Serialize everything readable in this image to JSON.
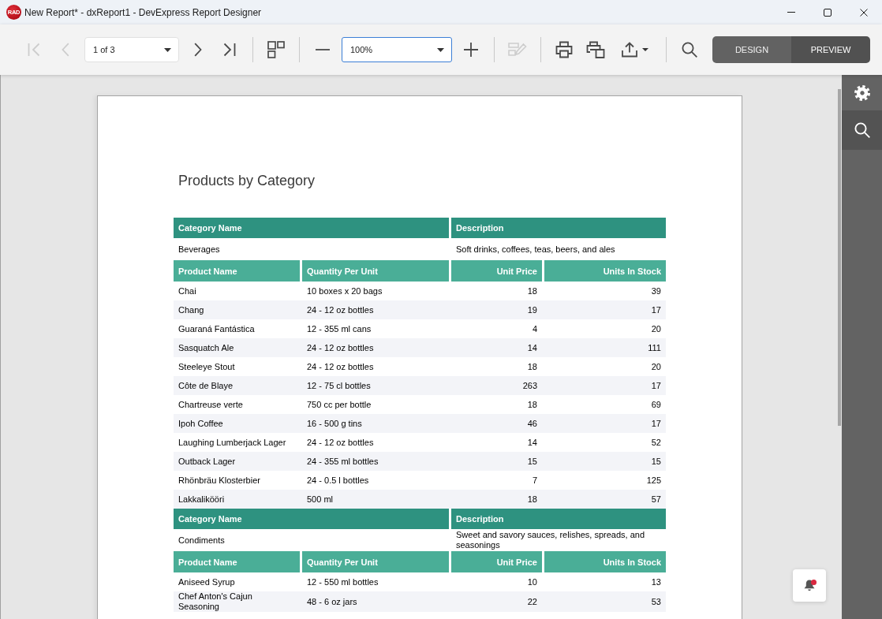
{
  "window": {
    "logo": "RAD",
    "title": "New Report* - dxReport1 - DevExpress Report Designer"
  },
  "toolbar": {
    "groups": [
      [
        {
          "kind": "first",
          "disabled": true
        },
        {
          "kind": "previous",
          "disabled": true
        },
        {
          "kind": "pages",
          "value": "1 of 3"
        },
        {
          "kind": "next",
          "disabled": false
        },
        {
          "kind": "last",
          "disabled": false
        }
      ],
      [
        {
          "kind": "multipage",
          "disabled": false
        }
      ],
      [
        {
          "kind": "zoomout",
          "disabled": false
        },
        {
          "kind": "zoom",
          "value": "100%",
          "focused": true
        },
        {
          "kind": "zoomin",
          "disabled": false
        }
      ],
      [
        {
          "kind": "edit",
          "disabled": true
        }
      ],
      [
        {
          "kind": "print",
          "disabled": false
        },
        {
          "kind": "quickprint",
          "disabled": false
        },
        {
          "kind": "export",
          "disabled": false
        }
      ],
      [
        {
          "kind": "search",
          "disabled": false
        }
      ]
    ],
    "mode_switch": [
      {
        "label": "DESIGN",
        "selected": false
      },
      {
        "label": "PREVIEW",
        "selected": true
      }
    ]
  },
  "side_panel": {
    "tabs": [
      {
        "kind": "settings",
        "selected": false
      },
      {
        "kind": "search",
        "selected": true
      }
    ]
  },
  "notifications": {
    "unread": true
  },
  "report": {
    "title": "Products by Category",
    "categories": [
      {
        "header": [
          "Category Name",
          "Description"
        ],
        "name": "Beverages",
        "description": "Soft drinks, coffees, teas, beers, and ales",
        "columns": [
          "Product Name",
          "Quantity Per Unit",
          "Unit Price",
          "Units In Stock"
        ],
        "products": [
          {
            "name": "Chai",
            "quantity": "10 boxes x 20 bags",
            "price": "18",
            "stock": "39"
          },
          {
            "name": "Chang",
            "quantity": "24 - 12 oz bottles",
            "price": "19",
            "stock": "17"
          },
          {
            "name": "Guaraná Fantástica",
            "quantity": "12 - 355 ml cans",
            "price": "4",
            "stock": "20"
          },
          {
            "name": "Sasquatch Ale",
            "quantity": "24 - 12 oz bottles",
            "price": "14",
            "stock": "111"
          },
          {
            "name": "Steeleye Stout",
            "quantity": "24 - 12 oz bottles",
            "price": "18",
            "stock": "20"
          },
          {
            "name": "Côte de Blaye",
            "quantity": "12 - 75 cl bottles",
            "price": "263",
            "stock": "17"
          },
          {
            "name": "Chartreuse verte",
            "quantity": "750 cc per bottle",
            "price": "18",
            "stock": "69"
          },
          {
            "name": "Ipoh Coffee",
            "quantity": "16 - 500 g tins",
            "price": "46",
            "stock": "17"
          },
          {
            "name": "Laughing Lumberjack Lager",
            "quantity": "24 - 12 oz bottles",
            "price": "14",
            "stock": "52"
          },
          {
            "name": "Outback Lager",
            "quantity": "24 - 355 ml bottles",
            "price": "15",
            "stock": "15"
          },
          {
            "name": "Rhönbräu Klosterbier",
            "quantity": "24 - 0.5 l bottles",
            "price": "7",
            "stock": "125"
          },
          {
            "name": "Lakkalikööri",
            "quantity": "500 ml",
            "price": "18",
            "stock": "57"
          }
        ]
      },
      {
        "header": [
          "Category Name",
          "Description"
        ],
        "name": "Condiments",
        "description": "Sweet and savory sauces, relishes, spreads, and seasonings",
        "columns": [
          "Product Name",
          "Quantity Per Unit",
          "Unit Price",
          "Units In Stock"
        ],
        "products": [
          {
            "name": "Aniseed Syrup",
            "quantity": "12 - 550 ml bottles",
            "price": "10",
            "stock": "13"
          },
          {
            "name": "Chef Anton's Cajun Seasoning",
            "quantity": "48 - 6 oz jars",
            "price": "22",
            "stock": "53"
          }
        ]
      }
    ]
  }
}
